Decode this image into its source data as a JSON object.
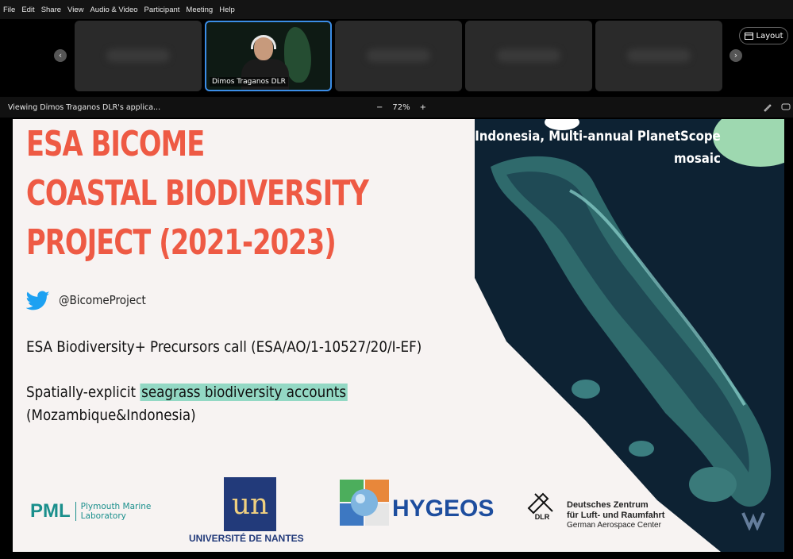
{
  "menu": [
    "File",
    "Edit",
    "Share",
    "View",
    "Audio & Video",
    "Participant",
    "Meeting",
    "Help"
  ],
  "strip": {
    "active_name": "Dimos Traganos DLR",
    "layout_label": "Layout",
    "prev_icon": "‹",
    "next_icon": "›"
  },
  "viewbar": {
    "viewing_text": "Viewing Dimos Traganos DLR's applica...",
    "zoom_out": "−",
    "zoom_level": "72%",
    "zoom_in": "+"
  },
  "slide": {
    "title_lines": [
      "ESA BICOME",
      "COASTAL BIODIVERSITY",
      "PROJECT (2021-2023)"
    ],
    "twitter_handle": "@BicomeProject",
    "call_text": "ESA Biodiversity+ Precursors call (ESA/AO/1-10527/20/I-EF)",
    "accounts_prefix": "Spatially-explicit ",
    "accounts_highlight": "seagrass biodiversity accounts",
    "accounts_line2": "(Mozambique&Indonesia)",
    "image_caption_line1": "Indonesia, Multi-annual PlanetScope",
    "image_caption_line2": "mosaic",
    "title_color": "#ee5a44",
    "highlight_color": "#93d8c4"
  },
  "logos": {
    "pml_main": "PML",
    "pml_sub1": "Plymouth Marine",
    "pml_sub2": "Laboratory",
    "nantes_mark": "un",
    "nantes": "UNIVERSITÉ DE NANTES",
    "hygeos": "HYGEOS",
    "dlr_mark": "DLR",
    "dlr_line1": "Deutsches Zentrum",
    "dlr_line2": "für Luft- und Raumfahrt",
    "dlr_line3": "German Aerospace Center"
  }
}
